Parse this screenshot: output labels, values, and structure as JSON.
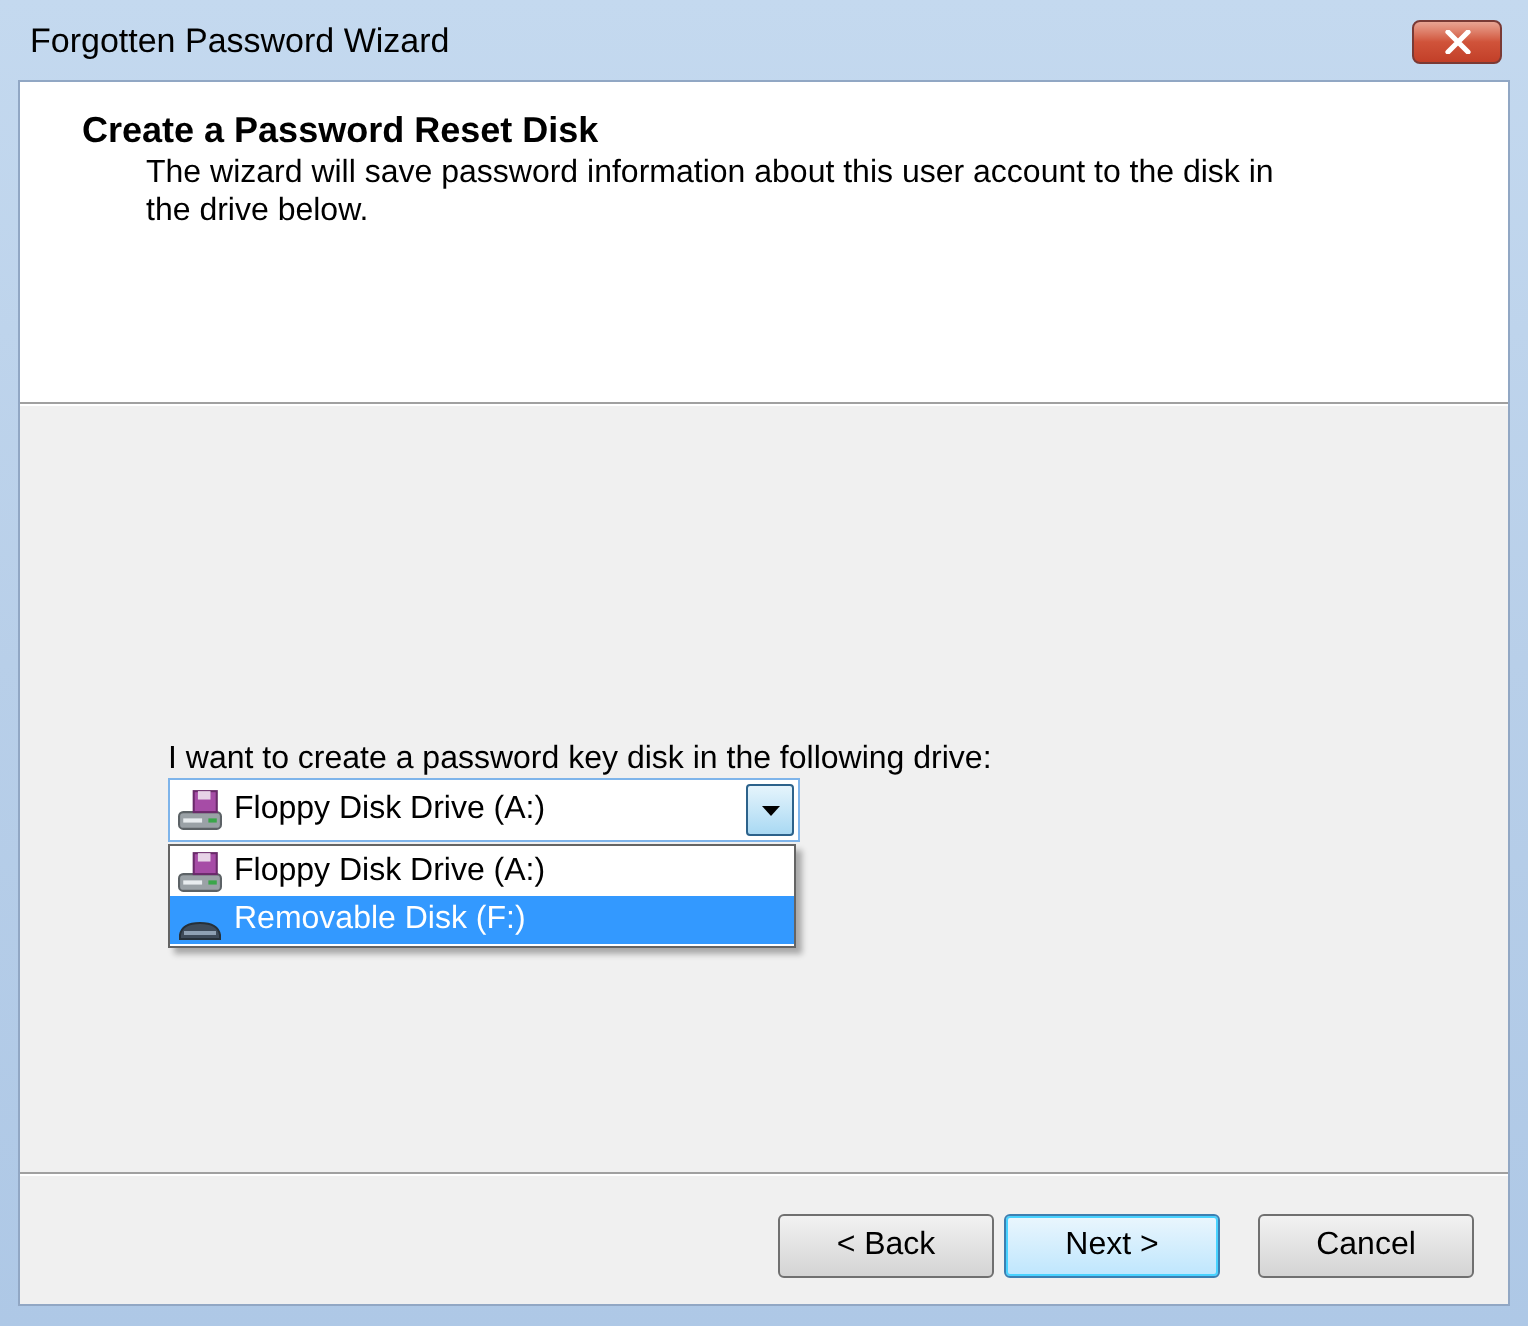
{
  "window": {
    "title": "Forgotten Password Wizard"
  },
  "header": {
    "title": "Create a Password Reset Disk",
    "description": "The wizard will save password information about this user account to the disk in the drive below."
  },
  "drive_prompt": "I want to create a password key disk in the following drive:",
  "drive_combo": {
    "value": {
      "label": "Floppy Disk Drive (A:)",
      "kind": "floppy"
    },
    "expanded": true,
    "options": [
      {
        "label": "Floppy Disk Drive (A:)",
        "kind": "floppy",
        "selected": false
      },
      {
        "label": "Removable Disk (F:)",
        "kind": "removable",
        "selected": true
      }
    ]
  },
  "buttons": [
    {
      "label": "< Back",
      "default": false
    },
    {
      "label": "Next >",
      "default": true
    },
    {
      "label": "Cancel",
      "default": false
    }
  ]
}
